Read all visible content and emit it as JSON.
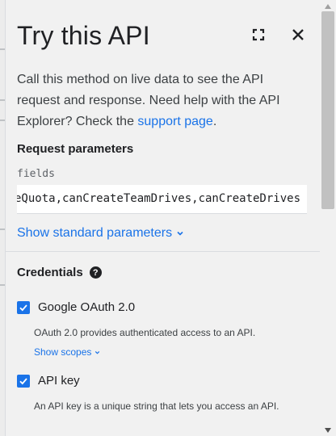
{
  "header": {
    "title": "Try this API"
  },
  "icons": {
    "fullscreen": "fullscreen-icon",
    "close": "close-icon",
    "help": "help-icon",
    "chevron": "chevron-down-icon",
    "check": "check-icon"
  },
  "description": {
    "text": "Call this method on live data to see the API request and response. Need help with the API Explorer? Check the ",
    "link_text": "support page",
    "suffix": "."
  },
  "request": {
    "heading": "Request parameters",
    "field_label": "fields",
    "field_value": "storageQuota,canCreateTeamDrives,canCreateDrives",
    "show_standard": "Show standard parameters"
  },
  "credentials": {
    "heading": "Credentials",
    "help_glyph": "?",
    "items": [
      {
        "label": "Google OAuth 2.0",
        "checked": true,
        "description": "OAuth 2.0 provides authenticated access to an API.",
        "link": "Show scopes"
      },
      {
        "label": "API key",
        "checked": true,
        "description": "An API key is a unique string that lets you access an API."
      }
    ]
  },
  "colors": {
    "accent": "#1a73e8",
    "panel": "#f1f1f1",
    "text": "#202124"
  }
}
